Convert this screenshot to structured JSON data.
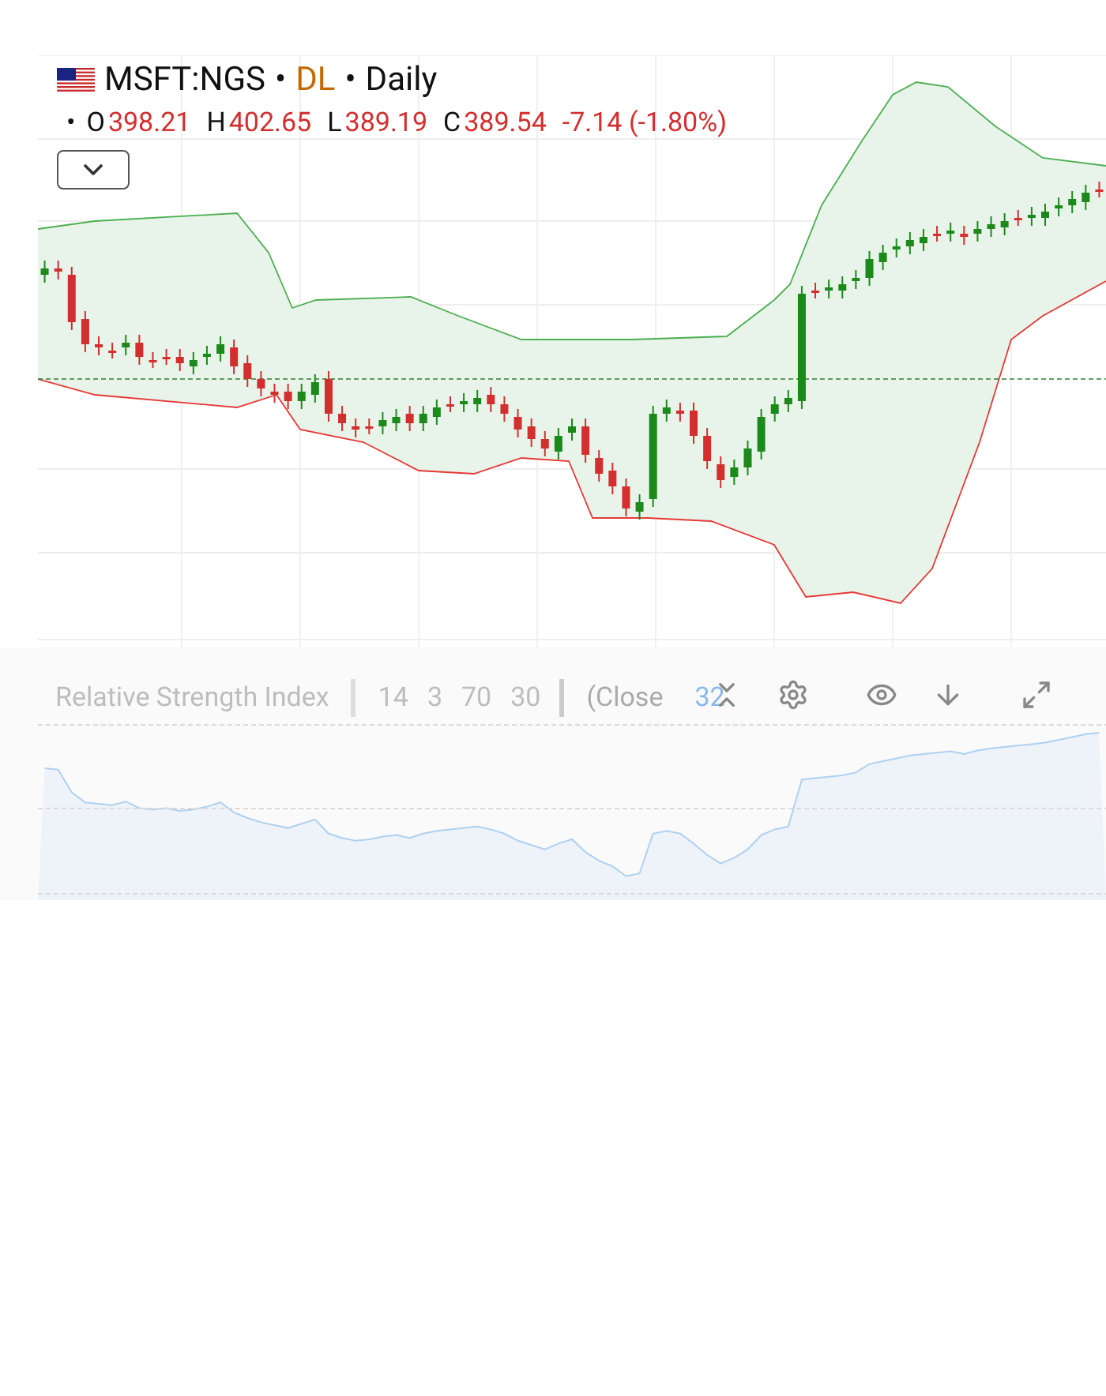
{
  "legend": {
    "symbol": "MSFT:NGS",
    "separator": "•",
    "source": "DL",
    "interval": "Daily",
    "bullet": "•",
    "ohlc": [
      {
        "label": "O",
        "value": "398.21"
      },
      {
        "label": "H",
        "value": "402.65"
      },
      {
        "label": "L",
        "value": "389.19"
      },
      {
        "label": "C",
        "value": "389.54"
      }
    ],
    "change": "-7.14 (-1.80%)"
  },
  "indicator": {
    "name": "Relative Strength Index",
    "params": [
      "14",
      "3",
      "70",
      "30"
    ],
    "source": "(Close",
    "value": "32"
  }
}
